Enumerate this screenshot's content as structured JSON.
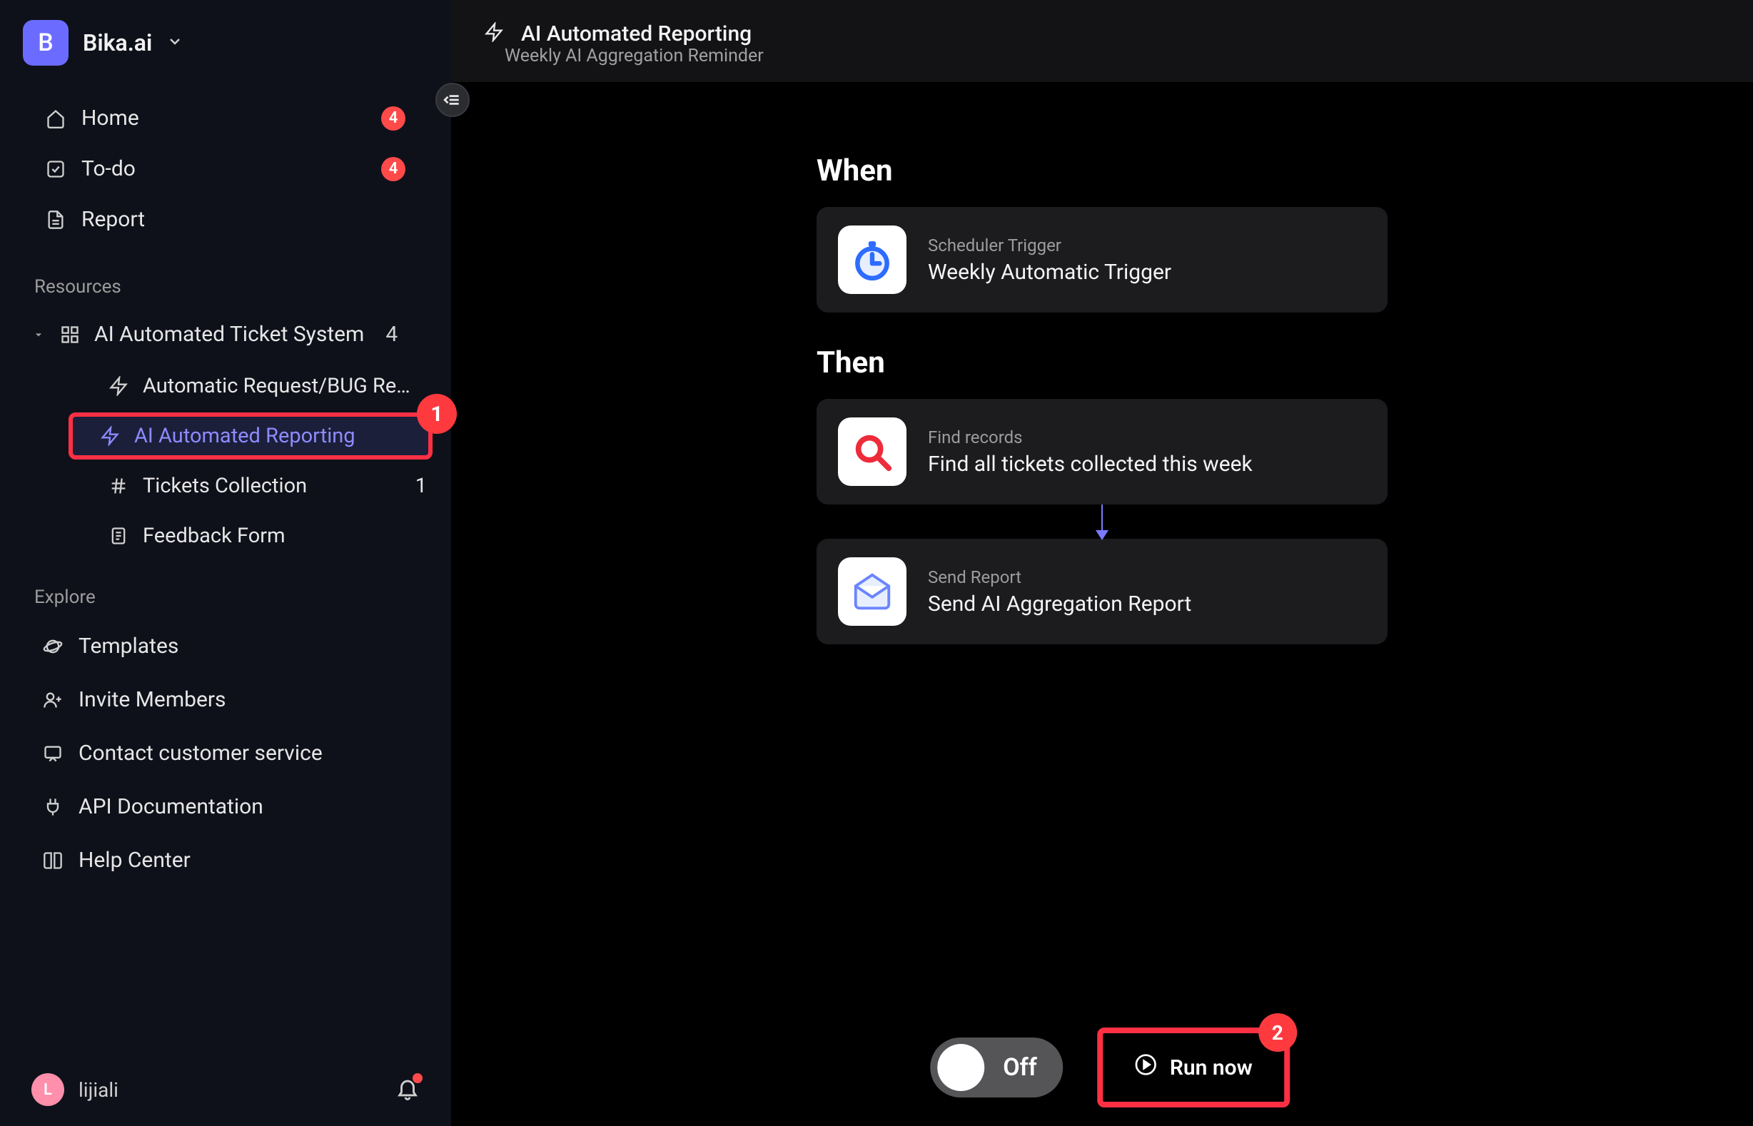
{
  "workspace": {
    "avatar_letter": "B",
    "name": "Bika.ai"
  },
  "nav": {
    "home": {
      "label": "Home",
      "badge": "4"
    },
    "todo": {
      "label": "To-do",
      "badge": "4"
    },
    "report": {
      "label": "Report"
    }
  },
  "sections": {
    "resources_title": "Resources",
    "explore_title": "Explore"
  },
  "resources": {
    "parent": {
      "label": "AI Automated Ticket System",
      "count": "4"
    },
    "items": [
      {
        "label": "Automatic Request/BUG Re…"
      },
      {
        "label": "AI Automated Reporting"
      },
      {
        "label": "Tickets Collection",
        "count": "1"
      },
      {
        "label": "Feedback Form"
      }
    ]
  },
  "explore": {
    "templates": "Templates",
    "invite": "Invite Members",
    "contact": "Contact customer service",
    "api": "API Documentation",
    "help": "Help Center"
  },
  "user": {
    "avatar_letter": "L",
    "name": "lijiali"
  },
  "header": {
    "title": "AI Automated Reporting",
    "subtitle": "Weekly AI Aggregation Reminder"
  },
  "flow": {
    "when_title": "When",
    "then_title": "Then",
    "trigger": {
      "kicker": "Scheduler Trigger",
      "title": "Weekly Automatic Trigger"
    },
    "step1": {
      "kicker": "Find records",
      "title": "Find all tickets collected this week"
    },
    "step2": {
      "kicker": "Send Report",
      "title": "Send AI Aggregation Report"
    }
  },
  "bottom": {
    "toggle_state_label": "Off",
    "run_label": "Run now"
  },
  "callouts": {
    "one": "1",
    "two": "2"
  }
}
